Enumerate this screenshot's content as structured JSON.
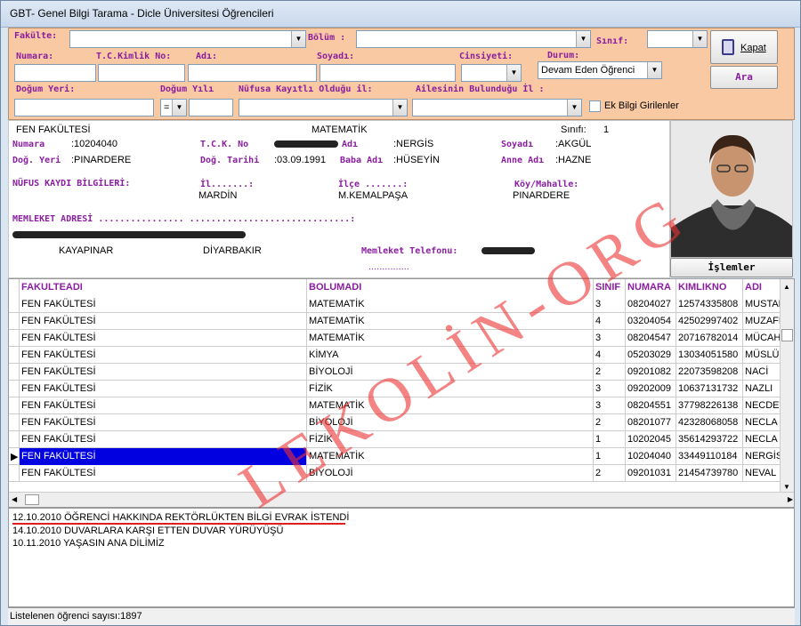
{
  "window": {
    "title": "GBT- Genel Bilgi Tarama - Dicle Üniversitesi Öğrencileri"
  },
  "filters": {
    "fakulte_label": "Fakülte:",
    "bolum_label": "Bölüm :",
    "sinif_label": "Sınıf:",
    "numara_label": "Numara:",
    "tckimlik_label": "T.C.Kimlik No:",
    "adi_label": "Adı:",
    "soyadi_label": "Soyadı:",
    "cinsiyeti_label": "Cinsiyeti:",
    "durum_label": "Durum:",
    "durum_value": "Devam Eden Öğrenci",
    "dogum_yeri_label": "Doğum Yeri:",
    "dogum_yili_label": "Doğum Yılı",
    "dogum_yili_op": "=",
    "nufus_label": "Nüfusa Kayıtlı Olduğu il:",
    "aile_label": "Ailesinin Bulunduğu İl :",
    "ek_bilgi_label": "Ek Bilgi Girilenler",
    "kapat_label": "Kapat",
    "ara_label": "Ara"
  },
  "student": {
    "faculty": "FEN FAKÜLTESİ",
    "department": "MATEMATİK",
    "sinif_label": "Sınıfı:",
    "sinif": "1",
    "numara_label": "Numara",
    "numara": ":10204040",
    "tck_label": "T.C.K. No",
    "adi_label": "Adı",
    "adi": ":NERGİS",
    "soyadi_label": "Soyadı",
    "soyadi": ":AKGÜL",
    "dog_yeri_label": "Doğ. Yeri",
    "dog_yeri": ":PINARDERE",
    "dog_tarihi_label": "Doğ. Tarihi",
    "dog_tarihi": ":03.09.1991",
    "baba_label": "Baba Adı",
    "baba": ":HÜSEYİN",
    "anne_label": "Anne Adı",
    "anne": ":HAZNE",
    "nufus_title": "NÜFUS KAYDI BİLGİLERİ:",
    "il_label": "İl.......:",
    "il": "MARDİN",
    "ilce_label": "İlçe .......:",
    "ilce": "M.KEMALPAŞA",
    "koy_label": "Köy/Mahalle:",
    "koy": "PINARDERE",
    "adres_title": "MEMLEKET ADRESİ ................ ..............................:",
    "adres_semt": "KAYAPINAR",
    "adres_il": "DİYARBAKIR",
    "telefon_label": "Memleket Telefonu:",
    "telefon_dots": "...............",
    "islemler_label": "İşlemler"
  },
  "table": {
    "columns": [
      "FAKULTEADI",
      "BOLUMADI",
      "SINIF",
      "NUMARA",
      "KIMLIKNO",
      "ADI"
    ],
    "rows": [
      [
        "FEN FAKÜLTESİ",
        "MATEMATİK",
        "3",
        "08204027",
        "12574335808",
        "MUSTAF"
      ],
      [
        "FEN FAKÜLTESİ",
        "MATEMATİK",
        "4",
        "03204054",
        "42502997402",
        "MUZAFF"
      ],
      [
        "FEN FAKÜLTESİ",
        "MATEMATİK",
        "3",
        "08204547",
        "20716782014",
        "MÜCAH"
      ],
      [
        "FEN FAKÜLTESİ",
        "KİMYA",
        "4",
        "05203029",
        "13034051580",
        "MÜSLÜN"
      ],
      [
        "FEN FAKÜLTESİ",
        "BİYOLOJİ",
        "2",
        "09201082",
        "22073598208",
        "NACİ"
      ],
      [
        "FEN FAKÜLTESİ",
        "FİZİK",
        "3",
        "09202009",
        "10637131732",
        "NAZLI"
      ],
      [
        "FEN FAKÜLTESİ",
        "MATEMATİK",
        "3",
        "08204551",
        "37798226138",
        "NECDET"
      ],
      [
        "FEN FAKÜLTESİ",
        "BİYOLOJİ",
        "2",
        "08201077",
        "42328068058",
        "NECLA"
      ],
      [
        "FEN FAKÜLTESİ",
        "FİZİK",
        "1",
        "10202045",
        "35614293722",
        "NECLA"
      ],
      [
        "FEN FAKÜLTESİ",
        "MATEMATİK",
        "1",
        "10204040",
        "33449110184",
        "NERGİS"
      ],
      [
        "FEN FAKÜLTESİ",
        "BİYOLOJİ",
        "2",
        "09201031",
        "21454739780",
        "NEVAL"
      ]
    ],
    "selected_row": 9
  },
  "notes": [
    "12.10.2010 ÖĞRENCİ HAKKINDA REKTÖRLÜKTEN BİLGİ EVRAK İSTENDİ",
    "14.10.2010 DUVARLARA KARŞI ETTEN DUVAR YÜRÜYÜŞÜ",
    "10.11.2010 YAŞASIN ANA DİLİMİZ"
  ],
  "status": {
    "text": "Listelenen öğrenci sayısı:1897"
  },
  "watermark": "LEKOLİN-ORG"
}
